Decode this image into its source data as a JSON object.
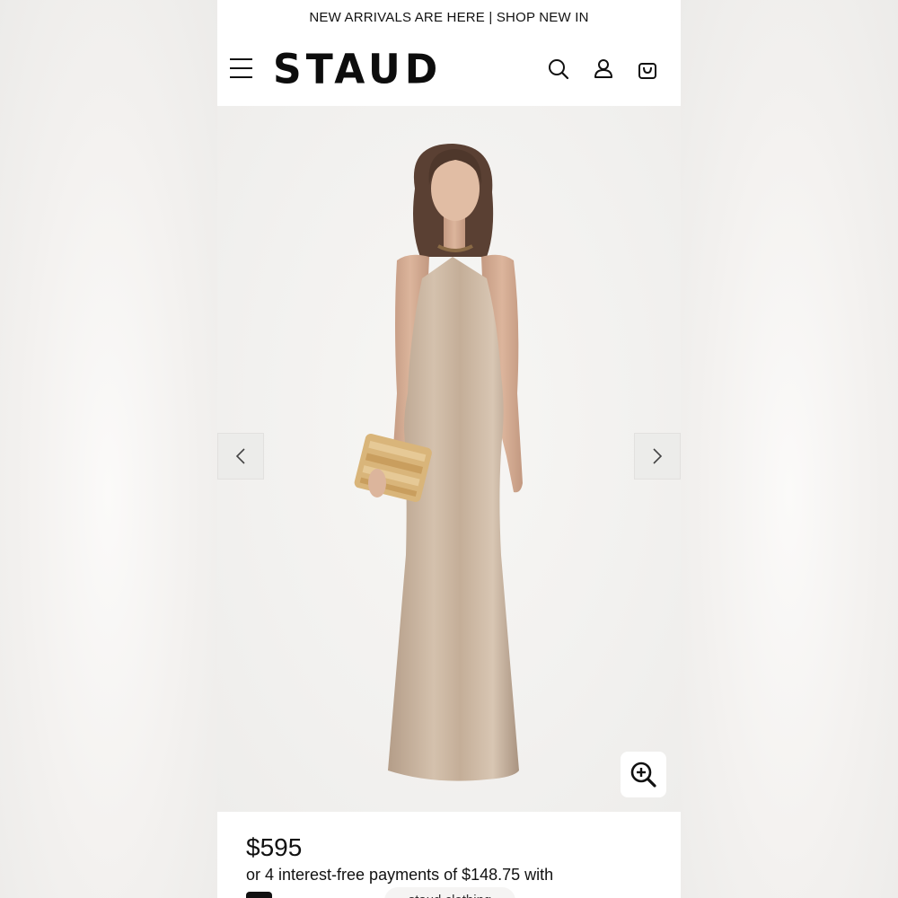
{
  "announcement": {
    "text": "NEW ARRIVALS ARE HERE | SHOP NEW IN"
  },
  "header": {
    "logo": "STAUD",
    "icons": [
      "menu-icon",
      "search-icon",
      "account-icon",
      "bag-icon"
    ]
  },
  "gallery": {
    "icons": [
      "chevron-left-icon",
      "chevron-right-icon",
      "zoom-in-icon"
    ],
    "dress_color": "#c7b19b",
    "background_color": "#f3f2f0"
  },
  "product": {
    "price": "$595",
    "installments": "or 4 interest-free payments of $148.75 with"
  },
  "overlay": {
    "handle": "staud.clothing"
  }
}
